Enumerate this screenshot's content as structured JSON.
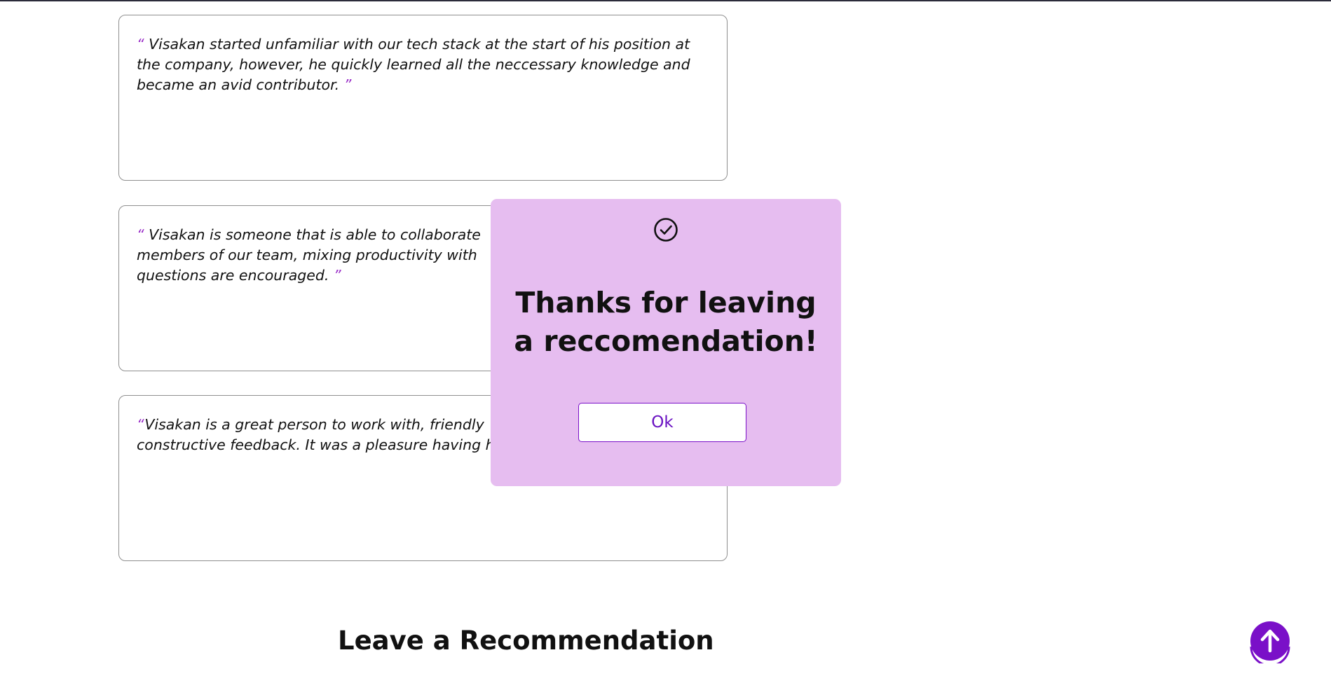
{
  "recommendations": [
    {
      "open_quote": "“",
      "text": " Visakan started unfamiliar with our tech stack at the start of his position at\nthe company, however, he quickly learned all the neccessary knowledge and\nbecame an avid contributor. ",
      "close_quote": "”"
    },
    {
      "open_quote": "“",
      "text": " Visakan is someone that is able to collaborate\nmembers of our team, mixing productivity with\nquestions are encouraged. ",
      "close_quote": "”"
    },
    {
      "open_quote": "“",
      "text": "Visakan is a great person to work with, friendly\nconstructive feedback. It was a pleasure having h",
      "close_quote": ""
    }
  ],
  "section": {
    "title": "Leave a Recommendation"
  },
  "modal": {
    "icon": "check-circle-icon",
    "title": "Thanks for leaving a reccomendation!",
    "ok_label": "Ok"
  },
  "scroll_top": {
    "icon": "arrow-up-icon"
  },
  "colors": {
    "accent": "#7a10c8",
    "modal_background": "#e6bdf0",
    "quote_mark": "#9b30c8"
  }
}
